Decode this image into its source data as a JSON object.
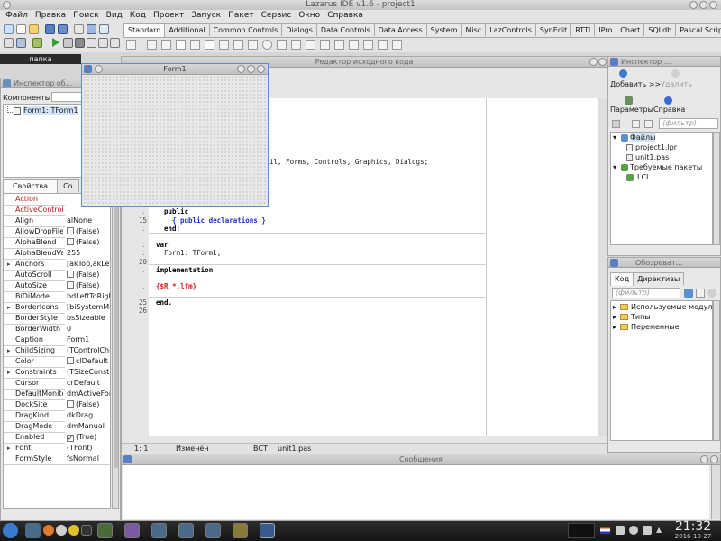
{
  "window_title": "Lazarus IDE v1.6 - project1",
  "menu": [
    "Файл",
    "Правка",
    "Поиск",
    "Вид",
    "Код",
    "Проект",
    "Запуск",
    "Пакет",
    "Сервис",
    "Окно",
    "Справка"
  ],
  "palette_tabs": [
    "Standard",
    "Additional",
    "Common Controls",
    "Dialogs",
    "Data Controls",
    "Data Access",
    "System",
    "Misc",
    "LazControls",
    "SynEdit",
    "RTTI",
    "IPro",
    "Chart",
    "SQLdb",
    "Pascal Script"
  ],
  "palette_active_tab": "Standard",
  "left_label": "папка",
  "object_inspector": {
    "title": "Инспектор об...",
    "components_label": "Компоненты",
    "tree_item": "Form1: TForm1",
    "tabs": [
      "Свойства",
      "Co"
    ],
    "properties": [
      {
        "name": "Action",
        "value": "",
        "red": true
      },
      {
        "name": "ActiveControl",
        "value": "",
        "red": true
      },
      {
        "name": "Align",
        "value": "alNone"
      },
      {
        "name": "AllowDropFiles",
        "value": "(False)",
        "check": true
      },
      {
        "name": "AlphaBlend",
        "value": "(False)",
        "check": true
      },
      {
        "name": "AlphaBlendVal",
        "value": "255"
      },
      {
        "name": "Anchors",
        "value": "[akTop,akLeft]",
        "expand": true
      },
      {
        "name": "AutoScroll",
        "value": "(False)",
        "check": true
      },
      {
        "name": "AutoSize",
        "value": "(False)",
        "check": true
      },
      {
        "name": "BiDiMode",
        "value": "bdLeftToRight"
      },
      {
        "name": "BorderIcons",
        "value": "[biSystemMen",
        "expand": true
      },
      {
        "name": "BorderStyle",
        "value": "bsSizeable"
      },
      {
        "name": "BorderWidth",
        "value": "0"
      },
      {
        "name": "Caption",
        "value": "Form1"
      },
      {
        "name": "ChildSizing",
        "value": "(TControlChild",
        "expand": true
      },
      {
        "name": "Color",
        "value": "clDefault",
        "swatch": true
      },
      {
        "name": "Constraints",
        "value": "(TSizeConstra",
        "expand": true
      },
      {
        "name": "Cursor",
        "value": "crDefault"
      },
      {
        "name": "DefaultMonito",
        "value": "dmActiveForm"
      },
      {
        "name": "DockSite",
        "value": "(False)",
        "check": true
      },
      {
        "name": "DragKind",
        "value": "dkDrag"
      },
      {
        "name": "DragMode",
        "value": "dmManual"
      },
      {
        "name": "Enabled",
        "value": "(True)",
        "check": true,
        "checked": true
      },
      {
        "name": "Font",
        "value": "(TFont)",
        "expand": true
      },
      {
        "name": "FormStyle",
        "value": "fsNormal"
      }
    ]
  },
  "form_designer": {
    "title": "Form1"
  },
  "source_editor": {
    "title": "Редактор исходного кода",
    "lines": [
      {
        "num": "",
        "text": "il, Forms, Controls, Graphics, Dialogs;",
        "kind": "plain",
        "indent": "hidden"
      },
      {
        "num": "",
        "text": "public",
        "kind": "kw",
        "indent": "  "
      },
      {
        "num": "15",
        "text": "{ public declarations }",
        "kind": "blue",
        "indent": "    "
      },
      {
        "num": "",
        "text": "end;",
        "kind": "kw",
        "indent": "  "
      },
      {
        "num": "",
        "text": "var",
        "kind": "kw",
        "indent": ""
      },
      {
        "num": "",
        "text": "Form1: TForm1;",
        "kind": "plain",
        "indent": "  "
      },
      {
        "num": "20",
        "text": "",
        "kind": "plain",
        "indent": ""
      },
      {
        "num": "",
        "text": "implementation",
        "kind": "kw",
        "indent": ""
      },
      {
        "num": "",
        "text": "{$R *.lfm}",
        "kind": "red",
        "indent": ""
      },
      {
        "num": "25",
        "text": "end.",
        "kind": "kw",
        "indent": ""
      },
      {
        "num": "26",
        "text": "",
        "kind": "plain",
        "indent": ""
      }
    ],
    "status": {
      "position": "1: 1",
      "modified": "Изменён",
      "mode": "ВСТ",
      "file": "unit1.pas"
    }
  },
  "project_inspector": {
    "title": "Инспектор ...",
    "add_label": "Добавить",
    "remove_label": "Удалить",
    "options_label": "Параметры",
    "help_label": "Справка",
    "filter_placeholder": "(фильтр)",
    "files_label": "Файлы",
    "files": [
      "project1.lpr",
      "unit1.pas"
    ],
    "required_label": "Требуемые пакеты",
    "packages": [
      "LCL"
    ]
  },
  "code_explorer": {
    "title": "Обозреват...",
    "tabs": [
      "Код",
      "Директивы"
    ],
    "filter_placeholder": "(фильтр)",
    "items": [
      "Используемые модули",
      "Типы",
      "Переменные"
    ]
  },
  "messages": {
    "title": "Сообщения"
  },
  "taskbar": {
    "time": "21:32",
    "date": "2016-10-27"
  }
}
